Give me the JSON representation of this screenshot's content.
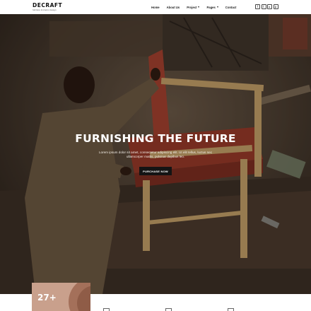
{
  "brand": {
    "name": "DECRAFT",
    "tagline": "furniture & interior design"
  },
  "nav": {
    "items": [
      {
        "label": "Home",
        "dropdown": false
      },
      {
        "label": "About Us",
        "dropdown": false
      },
      {
        "label": "Project",
        "dropdown": true
      },
      {
        "label": "Pages",
        "dropdown": true
      },
      {
        "label": "Contact",
        "dropdown": false
      }
    ]
  },
  "social": [
    {
      "icon": "facebook-icon",
      "glyph": "f"
    },
    {
      "icon": "twitter-icon",
      "glyph": "t"
    },
    {
      "icon": "youtube-icon",
      "glyph": "▸"
    },
    {
      "icon": "pinterest-icon",
      "glyph": "p"
    }
  ],
  "hero": {
    "title": "FURNISHING THE FUTURE",
    "text": "Lorem ipsum dolor sit amet, consectetur adipiscing elit. Ut elit tellus, luctus nec ullamcorper mattis, pulvinar dapibus leo.",
    "button_label": "PURCHASE NOW"
  },
  "stats": {
    "value": "27+"
  },
  "colors": {
    "accent": "#c9a08c",
    "button": "#141414",
    "chair_fabric": "#a8412f"
  }
}
